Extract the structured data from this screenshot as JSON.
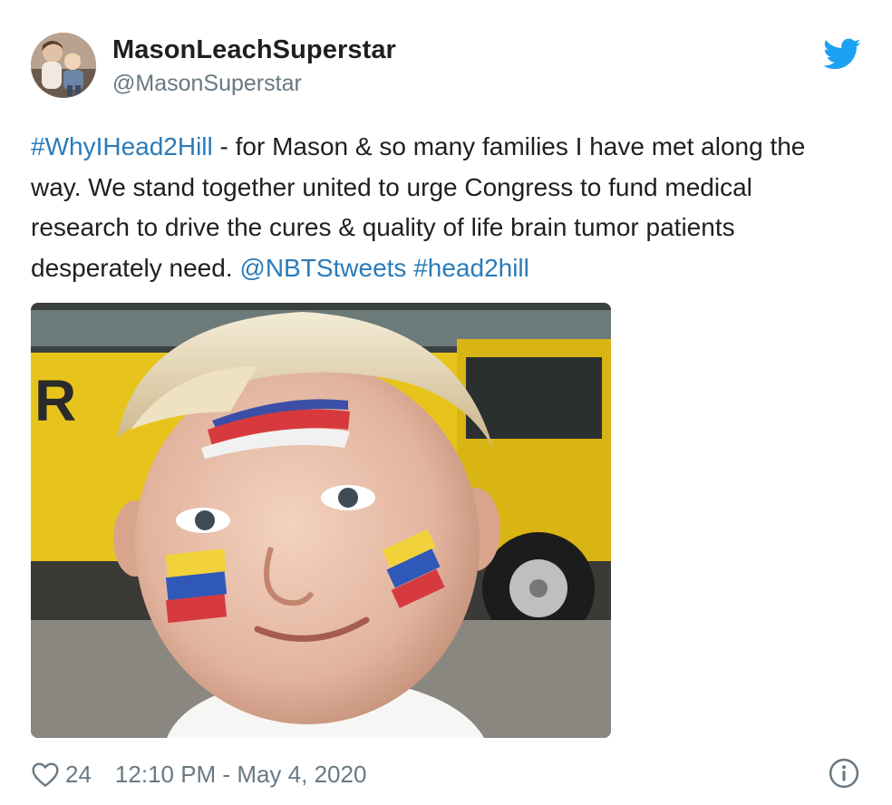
{
  "author": {
    "display_name": "MasonLeachSuperstar",
    "handle": "@MasonSuperstar"
  },
  "tweet": {
    "hashtag_1": "#WhyIHead2Hill",
    "text_1": " - for Mason & so many families I have met along the way. We stand together united to urge Congress to fund medical research to drive the cures & quality of life brain tumor patients desperately need. ",
    "mention": "@NBTStweets",
    "space": " ",
    "hashtag_2": "#head2hill"
  },
  "footer": {
    "like_count": "24",
    "timestamp": "12:10 PM - May 4, 2020"
  },
  "icons": {
    "brand": "twitter-bird-icon",
    "like": "heart-icon",
    "info": "info-icon"
  },
  "colors": {
    "link": "#2b7bb9",
    "twitter_blue": "#1da1f2",
    "muted": "#697882",
    "text": "#1c2022"
  }
}
